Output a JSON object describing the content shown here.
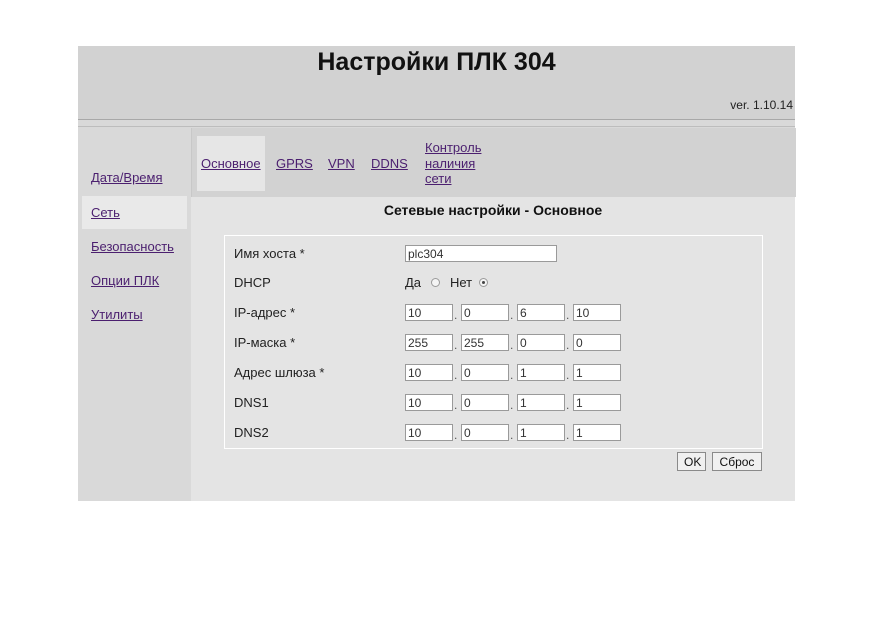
{
  "header": {
    "title": "Настройки ПЛК 304",
    "version": "ver. 1.10.14"
  },
  "sidebar": {
    "items": [
      {
        "label": "Дата/Время"
      },
      {
        "label": "Сеть"
      },
      {
        "label": "Безопасность"
      },
      {
        "label": "Опции ПЛК"
      },
      {
        "label": "Утилиты"
      }
    ]
  },
  "tabs": {
    "items": [
      {
        "label": "Основное"
      },
      {
        "label": "GPRS"
      },
      {
        "label": "VPN"
      },
      {
        "label": "DDNS"
      },
      {
        "label_lines": [
          "Контроль",
          "наличия",
          "сети"
        ]
      }
    ]
  },
  "section_title": "Сетевые настройки - Основное",
  "form": {
    "hostname": {
      "label": "Имя хоста *",
      "value": "plc304"
    },
    "dhcp": {
      "label": "DHCP",
      "yes_label": "Да",
      "no_label": "Нет",
      "selected": "Нет"
    },
    "ip": {
      "label": "IP-адрес *",
      "octets": [
        "10",
        "0",
        "6",
        "10"
      ]
    },
    "mask": {
      "label": "IP-маска *",
      "octets": [
        "255",
        "255",
        "0",
        "0"
      ]
    },
    "gateway": {
      "label": "Адрес шлюза *",
      "octets": [
        "10",
        "0",
        "1",
        "1"
      ]
    },
    "dns1": {
      "label": "DNS1",
      "octets": [
        "10",
        "0",
        "1",
        "1"
      ]
    },
    "dns2": {
      "label": "DNS2",
      "octets": [
        "10",
        "0",
        "1",
        "1"
      ]
    }
  },
  "buttons": {
    "ok": "OK",
    "reset": "Сброс"
  },
  "colors": {
    "link": "#4b1f6f",
    "panel": "#d9d9d9",
    "content": "#e4e4e4"
  }
}
